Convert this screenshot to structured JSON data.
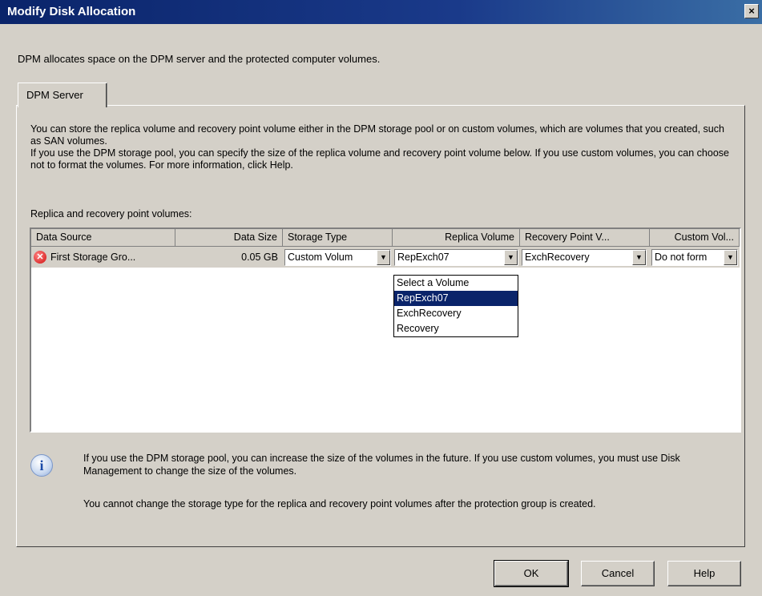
{
  "window": {
    "title": "Modify Disk Allocation",
    "close_label": "×"
  },
  "intro": "DPM allocates space on the DPM server and the protected computer volumes.",
  "tab": {
    "label": "DPM Server"
  },
  "description": [
    "You can store the replica volume and recovery point volume either in the DPM storage pool or on custom volumes, which are volumes that you created, such as SAN volumes.",
    "If you use the DPM storage pool, you can specify the size of the replica volume and recovery point volume below. If you use custom volumes, you can choose not to format the volumes. For more information, click Help."
  ],
  "grid": {
    "label": "Replica and recovery point volumes:",
    "columns": [
      "Data Source",
      "Data Size",
      "Storage Type",
      "Replica Volume",
      "Recovery Point V...",
      "Custom Vol..."
    ],
    "row": {
      "data_source": "First Storage Gro...",
      "data_size": "0.05 GB",
      "storage_type": "Custom Volum",
      "replica_volume": "RepExch07",
      "recovery_point": "ExchRecovery",
      "custom_vol": "Do not form"
    }
  },
  "dropdown": {
    "options": [
      "Select a Volume",
      "RepExch07",
      "ExchRecovery",
      "Recovery"
    ],
    "selected": "RepExch07"
  },
  "info": {
    "line1": "If you use the DPM storage pool, you can increase the size of the volumes in the future. If you use custom volumes, you must use Disk Management to change the size of the volumes.",
    "line2": "You cannot change the storage type for the replica and recovery point volumes after the protection group is created."
  },
  "buttons": {
    "ok": "OK",
    "cancel": "Cancel",
    "help": "Help"
  }
}
